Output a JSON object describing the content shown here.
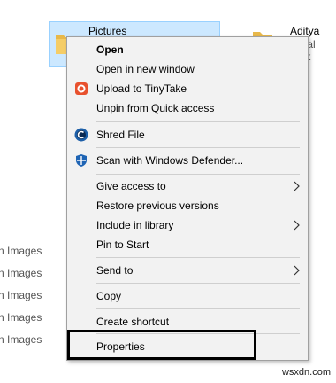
{
  "tiles": [
    {
      "name": "Pictures"
    },
    {
      "name": "Aditya",
      "sub": "Local Disk"
    }
  ],
  "sidebar_list": [
    "n Images",
    "n Images",
    "n Images",
    "n Images",
    "n Images"
  ],
  "menu": {
    "items": {
      "open": "Open",
      "open_new_window": "Open in new window",
      "upload_tinytake": "Upload to TinyTake",
      "unpin_quick_access": "Unpin from Quick access",
      "shred_file": "Shred File",
      "scan_defender": "Scan with Windows Defender...",
      "give_access": "Give access to",
      "restore_versions": "Restore previous versions",
      "include_library": "Include in library",
      "pin_start": "Pin to Start",
      "send_to": "Send to",
      "copy": "Copy",
      "create_shortcut": "Create shortcut",
      "properties": "Properties"
    },
    "icons": {
      "tinytake": "tinytake-icon",
      "shred": "shred-file-icon",
      "defender": "windows-defender-icon"
    }
  },
  "colors": {
    "selection_bg": "#cce8ff",
    "menu_bg": "#f2f2f2",
    "tinytake": "#e8512e",
    "shred": "#1d5fa8",
    "defender": "#1e64b4"
  },
  "watermark": "wsxdn.com"
}
